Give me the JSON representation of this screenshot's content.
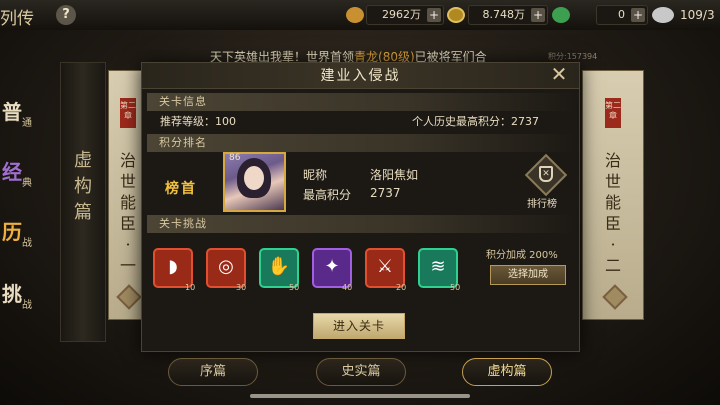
{
  "topbar": {
    "title": "列传",
    "help": "?",
    "resources": [
      {
        "icon": "copper-coin-icon",
        "value": "2962万",
        "color": "#c89030"
      },
      {
        "icon": "gold-ingot-icon",
        "value": "8.748万",
        "color": "#3ca050"
      },
      {
        "icon": "silver-coin-icon",
        "value": "0",
        "color": "#d0d0d0"
      }
    ],
    "capacity": "109/3"
  },
  "announcement": {
    "before": "天下英雄出我辈！世界首领",
    "highlight": "青龙(80级)",
    "after": "已被将军们合",
    "faint": "积分:157394"
  },
  "left_scroll": {
    "chars": [
      "虚",
      "构",
      "篇"
    ]
  },
  "left_card": {
    "seal": "第二章",
    "chars": [
      "治",
      "世",
      "能",
      "臣",
      "·",
      "一"
    ]
  },
  "right_card": {
    "seal": "第二章",
    "chars": [
      "治",
      "世",
      "能",
      "臣",
      "·",
      "二"
    ]
  },
  "side_tabs": [
    {
      "big": "普",
      "small": "通",
      "color": "#e8dcc0"
    },
    {
      "big": "经",
      "small": "典",
      "color": "#a070d0"
    },
    {
      "big": "历",
      "small": "战",
      "color": "#f0b040"
    },
    {
      "big": "挑",
      "small": "战",
      "color": "#e8dcc0"
    }
  ],
  "bottom_tabs": [
    "序篇",
    "史实篇",
    "虚构篇"
  ],
  "modal": {
    "title": "建业入侵战",
    "close": "✕",
    "level_info": {
      "heading": "关卡信息",
      "recommended_label": "推荐等级：",
      "recommended_value": "100",
      "best_label": "个人历史最高积分：",
      "best_value": "2737"
    },
    "ranking": {
      "heading": "积分排名",
      "rank_title": "榜首",
      "portrait_level": "86",
      "nickname_label": "昵称",
      "nickname_value": "洛阳焦如",
      "top_score_label": "最高积分",
      "top_score_value": "2737",
      "leaderboard_label": "排行榜"
    },
    "challenge": {
      "heading": "关卡挑战",
      "skills": [
        {
          "icon": "horn-icon",
          "glyph": "◗",
          "value": "10",
          "bg": "#9a2a18",
          "border": "#e05030"
        },
        {
          "icon": "target-icon",
          "glyph": "◎",
          "value": "30",
          "bg": "#9a2a18",
          "border": "#e05030"
        },
        {
          "icon": "hands-icon",
          "glyph": "✋",
          "value": "50",
          "bg": "#187a5a",
          "border": "#30d090"
        },
        {
          "icon": "whirl-icon",
          "glyph": "✦",
          "value": "40",
          "bg": "#5a2a8a",
          "border": "#a060e0"
        },
        {
          "icon": "blade-icon",
          "glyph": "⚔",
          "value": "20",
          "bg": "#9a2a18",
          "border": "#e05030"
        },
        {
          "icon": "wind-icon",
          "glyph": "≋",
          "value": "50",
          "bg": "#187a5a",
          "border": "#30d090"
        }
      ],
      "bonus_label": "积分加成 200%",
      "bonus_button": "选择加成"
    },
    "enter_button": "进入关卡"
  }
}
